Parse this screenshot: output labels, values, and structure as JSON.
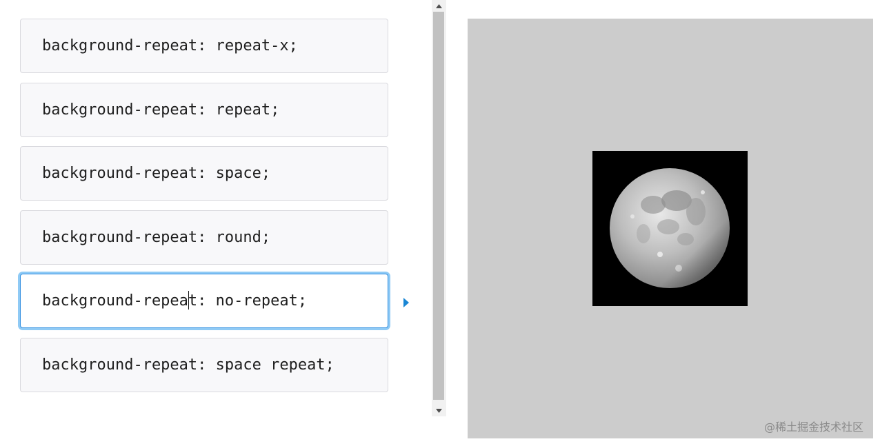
{
  "options": [
    {
      "label": "background-repeat: repeat-x;"
    },
    {
      "label": "background-repeat: repeat;"
    },
    {
      "label": "background-repeat: space;"
    },
    {
      "label": "background-repeat: round;"
    },
    {
      "label_before_caret": "background-repea",
      "label_after_caret": "t: no-repeat;"
    },
    {
      "label": "background-repeat: space repeat;"
    }
  ],
  "selected_index": 4,
  "watermark": "@稀土掘金技术社区",
  "colors": {
    "preview_background": "#cccccc",
    "image_background": "#000000",
    "focus_border": "#2f8ee0",
    "focus_glow": "#8fcaf5",
    "pointer": "#1a86d4"
  },
  "icons": {
    "pointer": "triangle-right-icon",
    "scroll_up": "arrow-up-icon",
    "scroll_down": "arrow-down-icon",
    "image": "moon-image"
  }
}
